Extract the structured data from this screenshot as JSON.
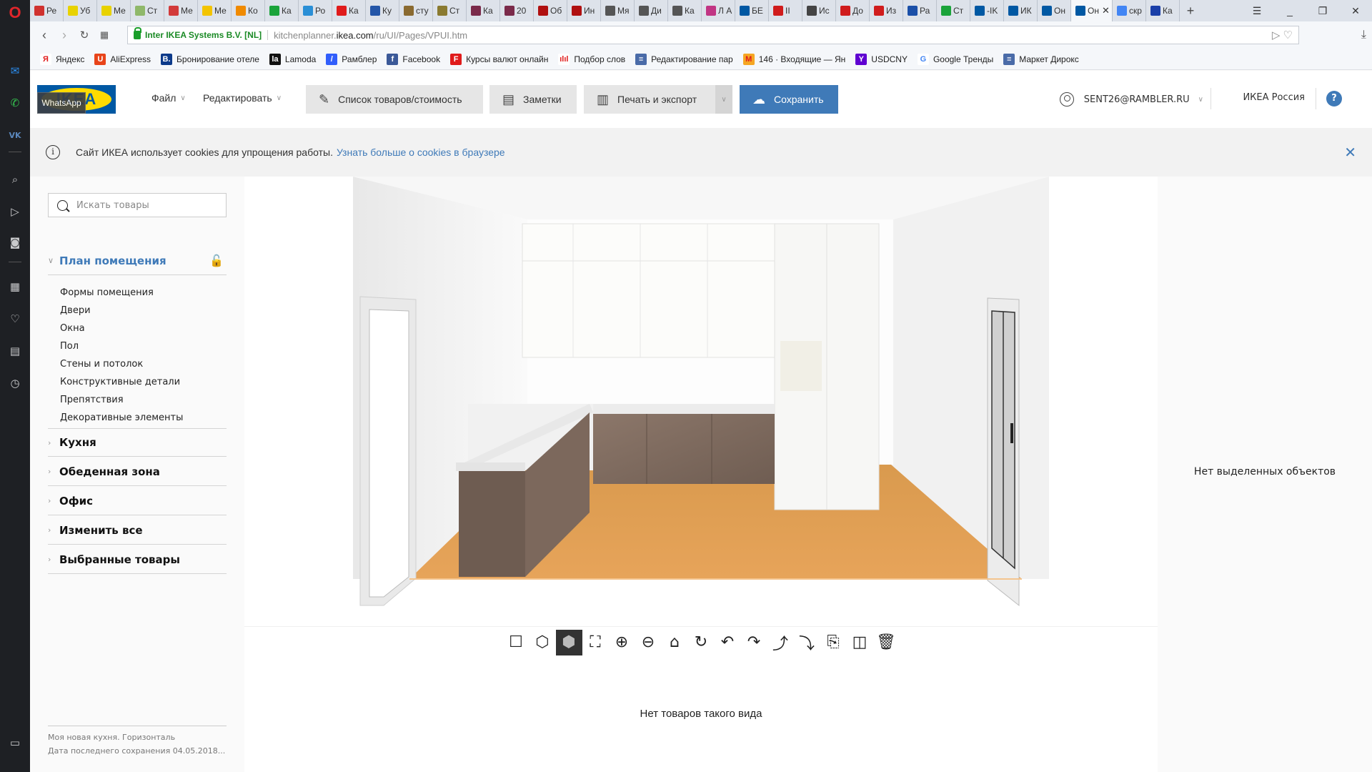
{
  "browser": {
    "tabs": [
      {
        "label": "Ре",
        "color": "#d0322f"
      },
      {
        "label": "Уб",
        "color": "#e8d200"
      },
      {
        "label": "Ме",
        "color": "#e8d200"
      },
      {
        "label": "Ст",
        "color": "#8fb86a"
      },
      {
        "label": "Ме",
        "color": "#d23a3a"
      },
      {
        "label": "Ме",
        "color": "#f3c400"
      },
      {
        "label": "Ко",
        "color": "#f08a00"
      },
      {
        "label": "Ка",
        "color": "#1aa33a"
      },
      {
        "label": "Ро",
        "color": "#2a8fd6"
      },
      {
        "label": "Ка",
        "color": "#e01b1b"
      },
      {
        "label": "Ку",
        "color": "#2456a8"
      },
      {
        "label": "сту",
        "color": "#8a6a30"
      },
      {
        "label": "Ст",
        "color": "#8a7a30"
      },
      {
        "label": "Ка",
        "color": "#7a2a4a"
      },
      {
        "label": "20",
        "color": "#7a2a4a"
      },
      {
        "label": "Об",
        "color": "#b01010"
      },
      {
        "label": "Ин",
        "color": "#b01010"
      },
      {
        "label": "Мя",
        "color": "#555555"
      },
      {
        "label": "Ди",
        "color": "#555555"
      },
      {
        "label": "Ка",
        "color": "#555555"
      },
      {
        "label": "Л А",
        "color": "#c13584"
      },
      {
        "label": "БЕ",
        "color": "#0058a3"
      },
      {
        "label": "II",
        "color": "#d01c1c"
      },
      {
        "label": "Ис",
        "color": "#444444"
      },
      {
        "label": "До",
        "color": "#d01c1c"
      },
      {
        "label": "Из",
        "color": "#d01c1c"
      },
      {
        "label": "Ра",
        "color": "#1a4fa8"
      },
      {
        "label": "Ст",
        "color": "#1aa33a"
      },
      {
        "label": "-IK",
        "color": "#0058a3"
      },
      {
        "label": "ИК",
        "color": "#0058a3"
      },
      {
        "label": "Он",
        "color": "#0058a3"
      },
      {
        "label": "Он",
        "color": "#0058a3",
        "active": true
      },
      {
        "label": "скр",
        "color": "#4285f4"
      },
      {
        "label": "Ка",
        "color": "#1a3fa8"
      }
    ],
    "new_tab": "+",
    "address": {
      "secure_label": "Inter IKEA Systems B.V. [NL]",
      "url_prefix": "kitchenplanner.",
      "url_domain": "ikea.com",
      "url_path": "/ru/UI/Pages/VPUI.htm"
    },
    "bookmarks": [
      {
        "label": "Яндекс",
        "icon": "Я",
        "color": "#ffffff",
        "fg": "#e01b1b"
      },
      {
        "label": "AliExpress",
        "icon": "U",
        "color": "#e8441a",
        "fg": "#ffffff"
      },
      {
        "label": "Бронирование отеле",
        "icon": "B.",
        "color": "#0c3a8a",
        "fg": "#ffffff"
      },
      {
        "label": "Lamoda",
        "icon": "la",
        "color": "#111111",
        "fg": "#ffffff"
      },
      {
        "label": "Рамблер",
        "icon": "/",
        "color": "#315efb",
        "fg": "#ffffff"
      },
      {
        "label": "Facebook",
        "icon": "f",
        "color": "#3b5998",
        "fg": "#ffffff"
      },
      {
        "label": "Курсы валют онлайн",
        "icon": "F",
        "color": "#e01b1b",
        "fg": "#ffffff"
      },
      {
        "label": "Подбор слов",
        "icon": "ılıl",
        "color": "#ffffff",
        "fg": "#e01b1b"
      },
      {
        "label": "Редактирование пар",
        "icon": "≡",
        "color": "#4a6ba8",
        "fg": "#ffffff"
      },
      {
        "label": "146 · Входящие — Ян",
        "icon": "M",
        "color": "#f5a623",
        "fg": "#e01b1b"
      },
      {
        "label": "USDCNY",
        "icon": "Y",
        "color": "#5f01d1",
        "fg": "#ffffff"
      },
      {
        "label": "Google Тренды",
        "icon": "G",
        "color": "#ffffff",
        "fg": "#4285f4"
      },
      {
        "label": "Маркет Дирокс",
        "icon": "≡",
        "color": "#4a6ba8",
        "fg": "#ffffff"
      }
    ]
  },
  "opera_sidebar": {
    "logo": "O",
    "items": [
      "messenger-icon",
      "whatsapp-icon",
      "vk-icon",
      "search-icon",
      "send-icon",
      "camera-icon",
      "speed-dial-icon",
      "heart-icon",
      "news-icon",
      "history-icon"
    ],
    "tooltip": "WhatsApp"
  },
  "header": {
    "logo_text": "IKEA",
    "menu": [
      {
        "label": "Файл"
      },
      {
        "label": "Редактировать"
      }
    ],
    "buttons": {
      "product_list": "Список товаров/стоимость",
      "notes": "Заметки",
      "print_export": "Печать и экспорт",
      "save": "Сохранить"
    },
    "user": "SENT26@RAMBLER.RU",
    "country": "ИКЕА Россия",
    "help": "?"
  },
  "cookie_bar": {
    "text": "Сайт ИКЕА использует cookies для упрощения работы.",
    "link": "Узнать больше о cookies в браузере"
  },
  "left_panel": {
    "search_placeholder": "Искать товары",
    "open_section": "План помещения",
    "sub_items": [
      "Формы помещения",
      "Двери",
      "Окна",
      "Пол",
      "Стены и потолок",
      "Конструктивные детали",
      "Препятствия",
      "Декоративные элементы"
    ],
    "sections": [
      "Кухня",
      "Обеденная зона",
      "Офис",
      "Изменить все",
      "Выбранные товары"
    ],
    "project_name": "Моя новая кухня. Горизонталь",
    "last_saved": "Дата последнего сохранения 04.05.2018..."
  },
  "viewer_toolbar": [
    {
      "name": "view-2d-icon",
      "glyph": "☐"
    },
    {
      "name": "view-3d-wire-icon",
      "glyph": "⬡"
    },
    {
      "name": "view-3d-solid-icon",
      "glyph": "⬢",
      "active": true
    },
    {
      "name": "zoom-fit-icon",
      "glyph": "⛶"
    },
    {
      "name": "zoom-in-icon",
      "glyph": "⊕"
    },
    {
      "name": "zoom-out-icon",
      "glyph": "⊖"
    },
    {
      "name": "home-view-icon",
      "glyph": "⌂"
    },
    {
      "name": "rotate-icon",
      "glyph": "↻"
    },
    {
      "name": "rotate-left-icon",
      "glyph": "↶"
    },
    {
      "name": "rotate-right-icon",
      "glyph": "↷"
    },
    {
      "name": "tilt-up-icon",
      "glyph": "⤴"
    },
    {
      "name": "tilt-down-icon",
      "glyph": "⤵"
    },
    {
      "name": "rotate-object-icon",
      "glyph": "⎘"
    },
    {
      "name": "wall-view-icon",
      "glyph": "◫"
    },
    {
      "name": "delete-icon",
      "glyph": "🗑"
    }
  ],
  "products_panel": {
    "empty_text": "Нет товаров такого вида"
  },
  "right_panel": {
    "empty_text": "Нет выделенных объектов"
  }
}
